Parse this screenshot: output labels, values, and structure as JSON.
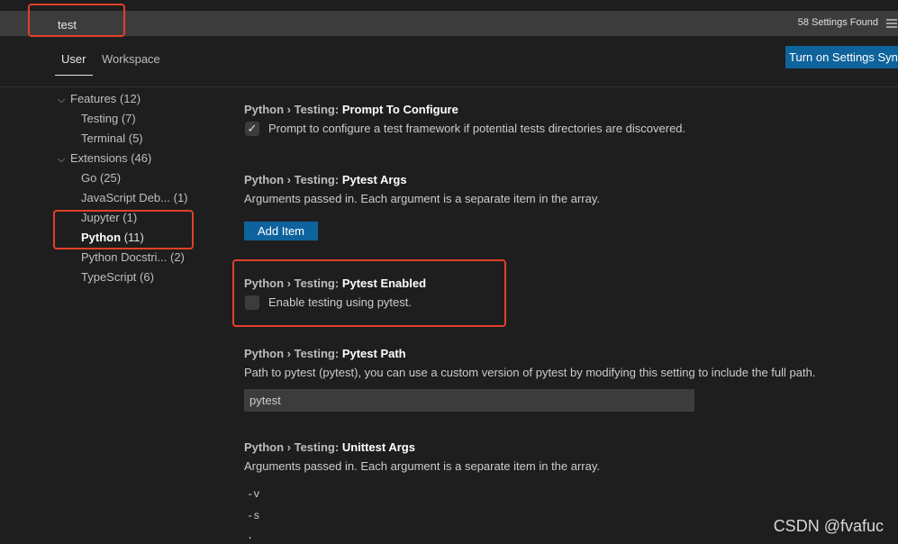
{
  "search": {
    "value": "test",
    "results_count": "58 Settings Found"
  },
  "tabs": [
    {
      "label": "User",
      "active": true
    },
    {
      "label": "Workspace",
      "active": false
    }
  ],
  "sync_button": {
    "label": "Turn on Settings Syn"
  },
  "tree": [
    {
      "label": "Features",
      "count": "(12)",
      "expanded": true,
      "level": 0
    },
    {
      "label": "Testing",
      "count": "(7)",
      "level": 1
    },
    {
      "label": "Terminal",
      "count": "(5)",
      "level": 1
    },
    {
      "label": "Extensions",
      "count": "(46)",
      "expanded": true,
      "level": 0
    },
    {
      "label": "Go",
      "count": "(25)",
      "level": 1
    },
    {
      "label": "JavaScript Deb...",
      "count": "(1)",
      "level": 1
    },
    {
      "label": "Jupyter",
      "count": "(1)",
      "level": 1
    },
    {
      "label": "Python",
      "count": "(11)",
      "level": 1,
      "selected": true
    },
    {
      "label": "Python Docstri...",
      "count": "(2)",
      "level": 1
    },
    {
      "label": "TypeScript",
      "count": "(6)",
      "level": 1
    }
  ],
  "settings": [
    {
      "crumb": "Python › Testing: ",
      "name": "Prompt To Configure",
      "description": "Prompt to configure a test framework if potential tests directories are discovered.",
      "checked": true
    },
    {
      "crumb": "Python › Testing: ",
      "name": "Pytest Args",
      "description": "Arguments passed in. Each argument is a separate item in the array.",
      "button": "Add Item"
    },
    {
      "crumb": "Python › Testing: ",
      "name": "Pytest Enabled",
      "description": "Enable testing using pytest.",
      "checked": false
    },
    {
      "crumb": "Python › Testing: ",
      "name": "Pytest Path",
      "description": "Path to pytest (pytest), you can use a custom version of pytest by modifying this setting to include the full path.",
      "value": "pytest"
    },
    {
      "crumb": "Python › Testing: ",
      "name": "Unittest Args",
      "description": "Arguments passed in. Each argument is a separate item in the array.",
      "items": [
        "-v",
        "-s",
        "."
      ]
    }
  ],
  "watermark": "CSDN @fvafuc",
  "colors": {
    "highlight": "#e0402a",
    "button": "#0e639c",
    "background": "#1e1e1e"
  }
}
